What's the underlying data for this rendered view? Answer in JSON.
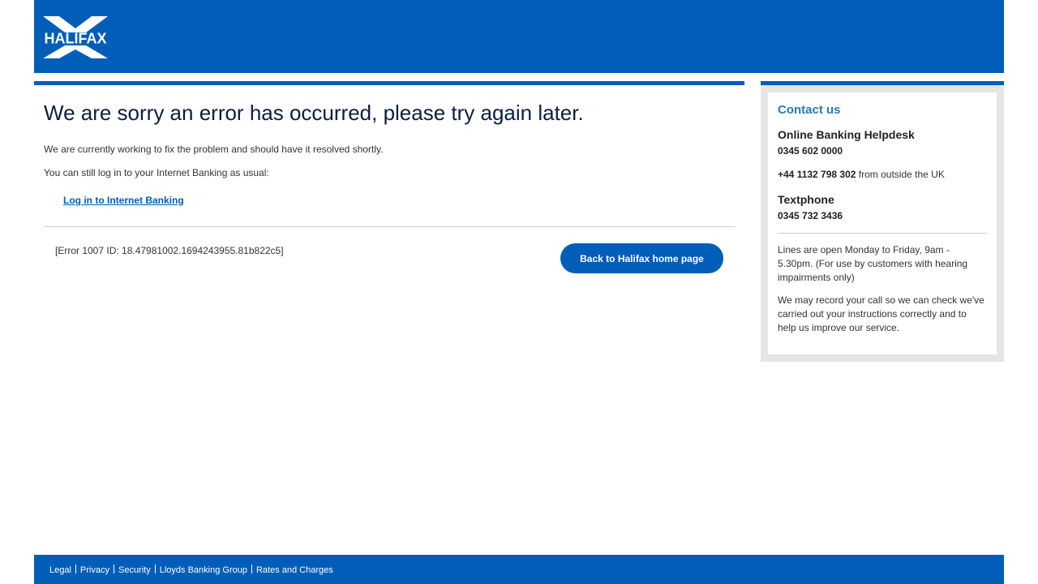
{
  "header": {
    "logo_text": "HALIFAX",
    "logo_alt": "Halifax"
  },
  "main": {
    "title": "We are sorry an error has occurred, please try again later.",
    "paragraph_1": "We are currently working to fix the problem and should have it resolved shortly.",
    "paragraph_2": "You can still log in to your Internet Banking as usual:",
    "login_link": "Log in to Internet Banking",
    "error_code": "[Error 1007 ID: 18.47981002.1694243955.81b822c5]",
    "home_button": "Back to Halifax home page"
  },
  "sidebar": {
    "title": "Contact us",
    "helpdesk_title": "Online Banking Helpdesk",
    "helpdesk_phone": "0345 602 0000",
    "intl_phone": "+44 1132 798 302",
    "intl_suffix": " from outside the UK",
    "textphone_title": "Textphone",
    "textphone_number": "0345 732 3436",
    "hours_text": "Lines are open Monday to Friday, 9am - 5.30pm. (For use by customers with hearing impairments only)",
    "record_text": "We may record your call so we can check we've carried out your instructions correctly and to help us improve our service."
  },
  "footer": {
    "links": [
      "Legal",
      "Privacy",
      "Security",
      "Lloyds Banking Group",
      "Rates and Charges"
    ]
  },
  "colors": {
    "brand_blue": "#005eb8",
    "title_dark": "#0b1f3f",
    "contact_title": "#2a7ab5",
    "sidebar_bg": "#e5e5e5"
  }
}
